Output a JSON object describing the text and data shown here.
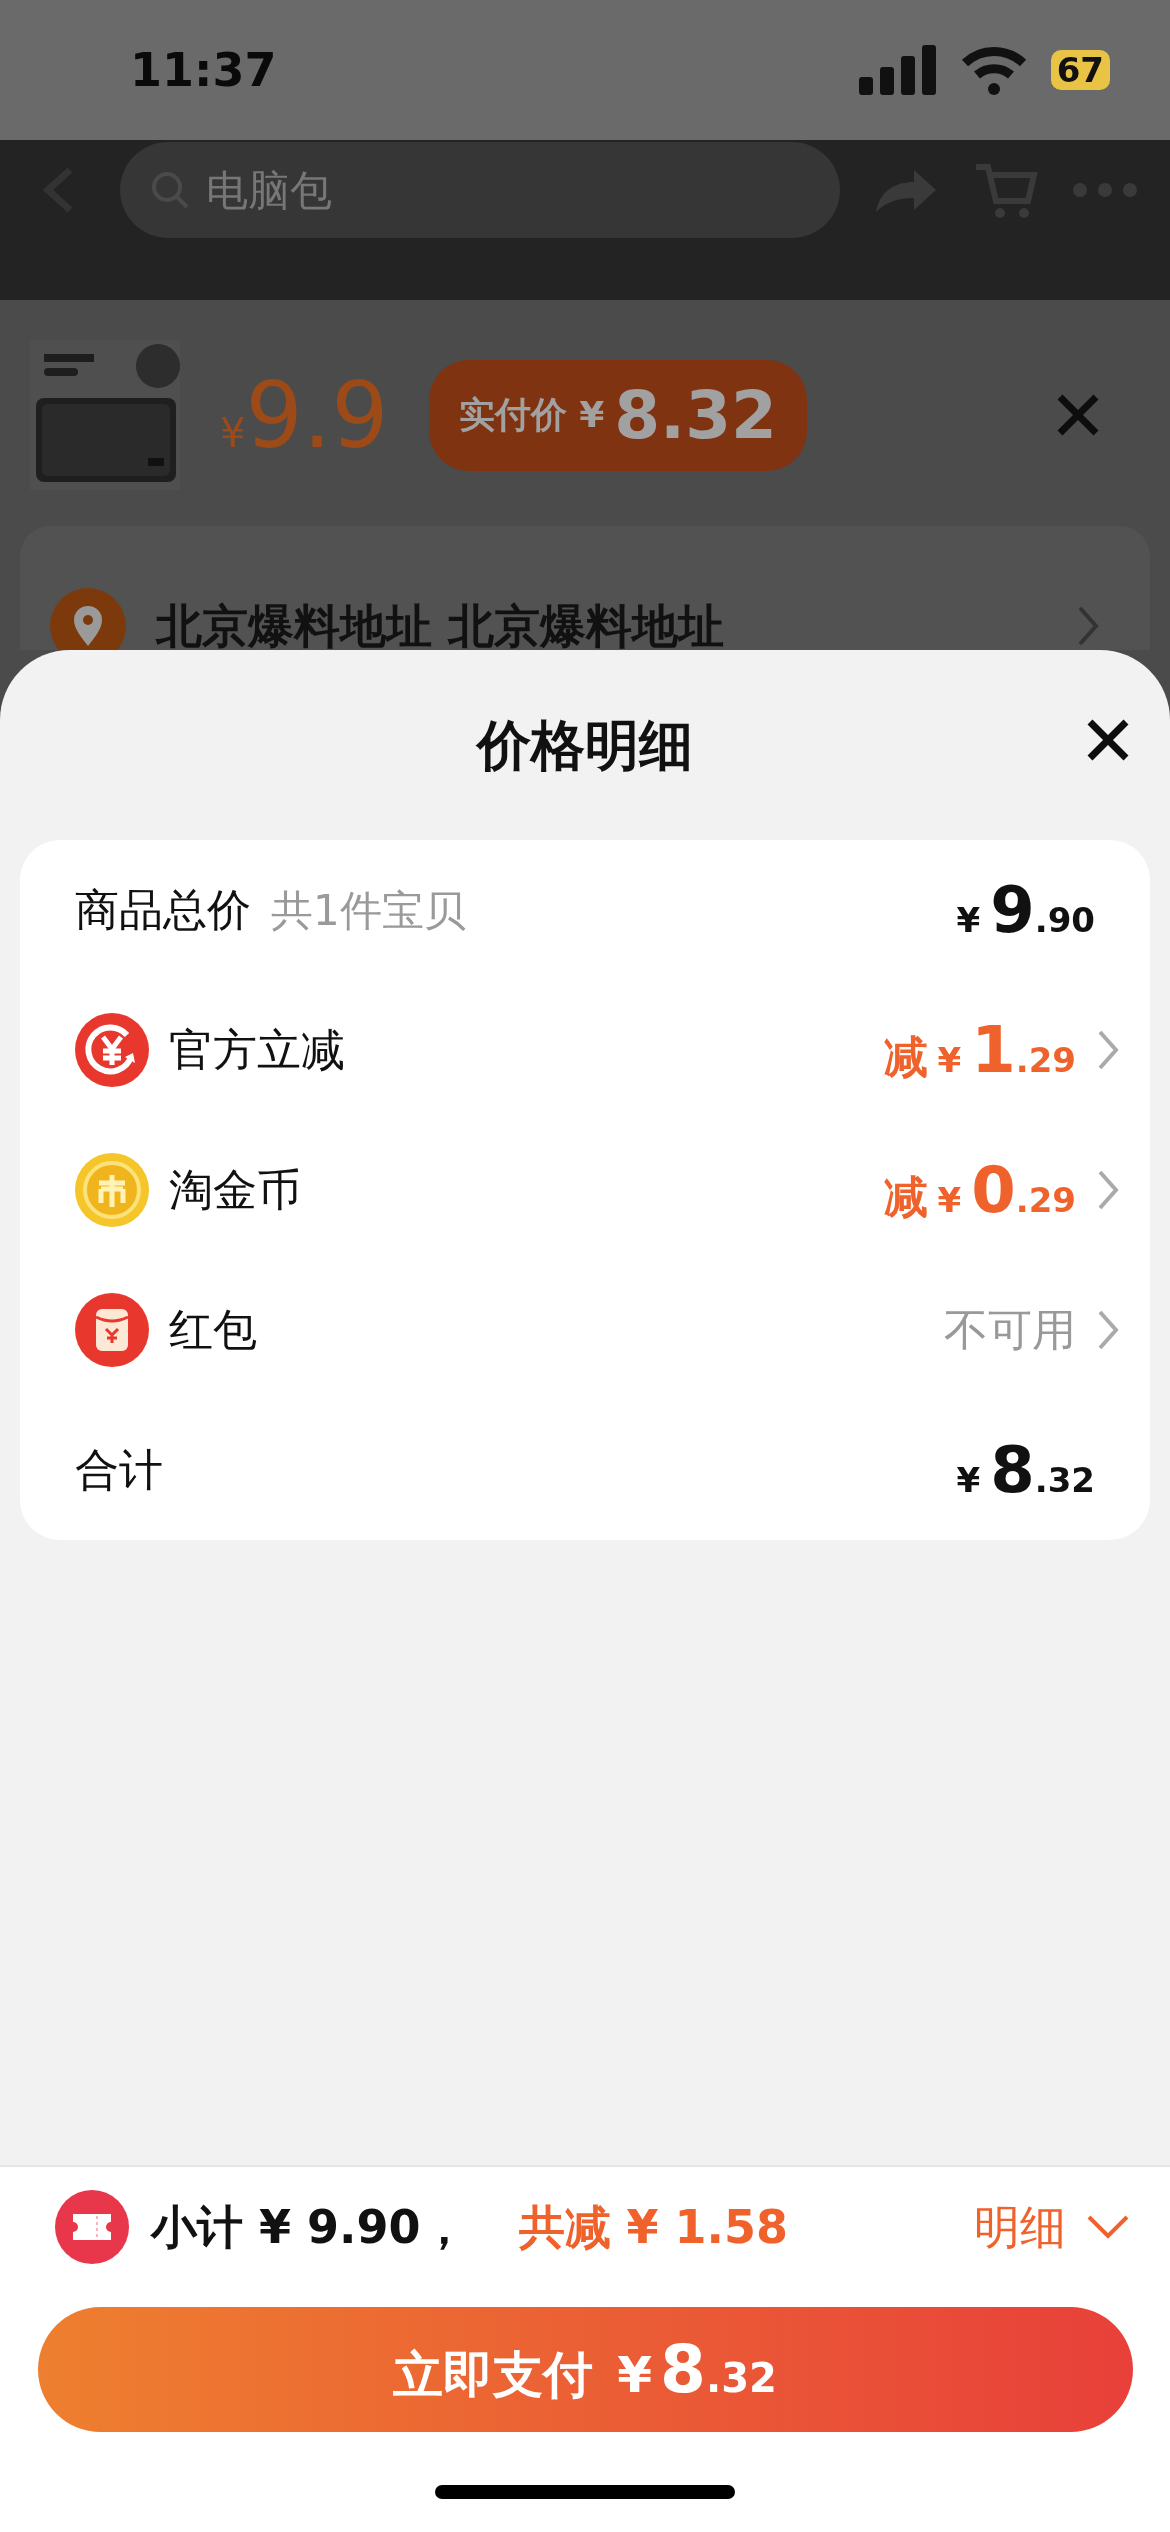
{
  "status_bar": {
    "time": "11:37",
    "battery": "67"
  },
  "background": {
    "search": {
      "placeholder": "电脑包"
    },
    "product": {
      "kind": "picture",
      "currency": "¥",
      "price": "9.9",
      "actual_label": "实付价",
      "actual_currency": "¥",
      "actual_price": "8.32"
    },
    "address": {
      "title": "北京爆料地址 北京爆料地址"
    }
  },
  "sheet": {
    "title": "价格明细",
    "rows": [
      {
        "kind": "amount",
        "label": "商品总价",
        "note": "共1件宝贝",
        "currency": "¥",
        "integer": "9",
        "decimal": ".90"
      },
      {
        "kind": "discount",
        "label": "官方立减",
        "prefix": "减",
        "currency": "¥",
        "integer": "1",
        "decimal": ".29"
      },
      {
        "kind": "discount",
        "label": "淘金币",
        "prefix": "减",
        "currency": "¥",
        "integer": "0",
        "decimal": ".29"
      },
      {
        "kind": "status",
        "label": "红包",
        "value": "不可用"
      },
      {
        "kind": "amount",
        "label": "合计",
        "currency": "¥",
        "integer": "8",
        "decimal": ".32"
      }
    ]
  },
  "footer": {
    "subtotal": "小计 ¥ 9.90，",
    "savings": "共减 ¥ 1.58",
    "details": "明细",
    "pay": {
      "label": "立即支付",
      "currency": "¥",
      "integer": "8",
      "decimal": ".32"
    }
  }
}
